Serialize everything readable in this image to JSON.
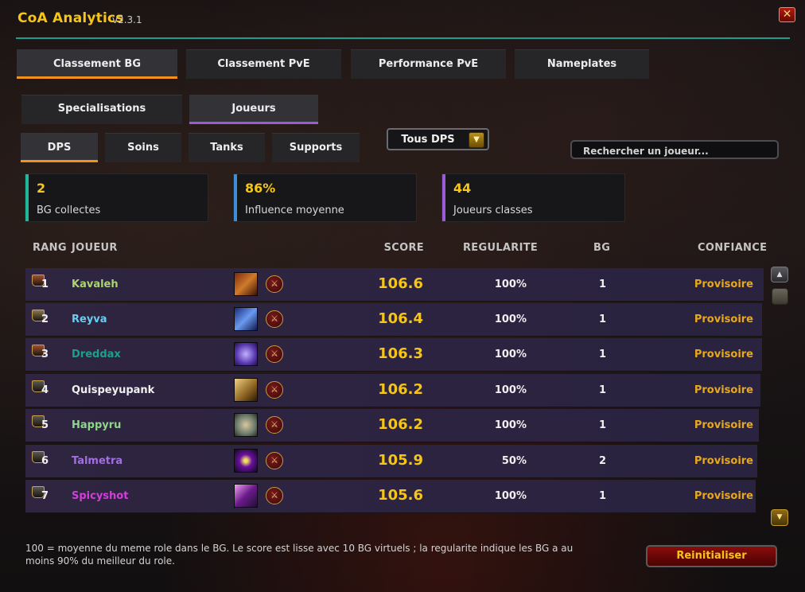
{
  "window": {
    "title": "CoA Analytics",
    "version": "v2.3.1",
    "close_icon": "close-icon"
  },
  "main_tabs": [
    {
      "label": "Classement BG",
      "active": true
    },
    {
      "label": "Classement PvE",
      "active": false
    },
    {
      "label": "Performance PvE",
      "active": false
    },
    {
      "label": "Nameplates",
      "active": false
    }
  ],
  "sub_tabs": [
    {
      "label": "Specialisations",
      "active": false
    },
    {
      "label": "Joueurs",
      "active": true
    }
  ],
  "role_tabs": [
    {
      "label": "DPS",
      "active": true
    },
    {
      "label": "Soins",
      "active": false
    },
    {
      "label": "Tanks",
      "active": false
    },
    {
      "label": "Supports",
      "active": false
    }
  ],
  "filter": {
    "selected": "Tous DPS",
    "icon": "chevron-down-icon"
  },
  "search": {
    "placeholder": "Rechercher un joueur..."
  },
  "stats": [
    {
      "value": "2",
      "label": "BG collectes",
      "color": "#1fb89a"
    },
    {
      "value": "86%",
      "label": "Influence moyenne",
      "color": "#3a8fd8"
    },
    {
      "value": "44",
      "label": "Joueurs classes",
      "color": "#9a5bd8"
    }
  ],
  "table": {
    "headers": {
      "rank": "RANG",
      "player": "JOUEUR",
      "score": "SCORE",
      "regularity": "REGULARITE",
      "bg": "BG",
      "confidence": "CONFIANCE"
    },
    "rows": [
      {
        "rank": "1",
        "name": "Kavaleh",
        "name_color": "#abd473",
        "score": "106.6",
        "regularity": "100%",
        "bg": "1",
        "confidence": "Provisoire",
        "rank_icon_color": "#a0522d",
        "spec_icon": "spec-fury-icon"
      },
      {
        "rank": "2",
        "name": "Reyva",
        "name_color": "#69ccf0",
        "score": "106.4",
        "regularity": "100%",
        "bg": "1",
        "confidence": "Provisoire",
        "rank_icon_color": "#8a7a50",
        "spec_icon": "spec-frost-icon"
      },
      {
        "rank": "3",
        "name": "Dreddax",
        "name_color": "#1e9f8a",
        "score": "106.3",
        "regularity": "100%",
        "bg": "1",
        "confidence": "Provisoire",
        "rank_icon_color": "#a0522d",
        "spec_icon": "spec-arcane-icon"
      },
      {
        "rank": "4",
        "name": "Quispeyupank",
        "name_color": "#f0f0f0",
        "score": "106.2",
        "regularity": "100%",
        "bg": "1",
        "confidence": "Provisoire",
        "rank_icon_color": "#5a5a50",
        "spec_icon": "spec-holy-icon"
      },
      {
        "rank": "5",
        "name": "Happyru",
        "name_color": "#8fd58a",
        "score": "106.2",
        "regularity": "100%",
        "bg": "1",
        "confidence": "Provisoire",
        "rank_icon_color": "#5a5a50",
        "spec_icon": "spec-totem-icon"
      },
      {
        "rank": "6",
        "name": "Talmetra",
        "name_color": "#a070e0",
        "score": "105.9",
        "regularity": "50%",
        "bg": "2",
        "confidence": "Provisoire",
        "rank_icon_color": "#5a5a50",
        "spec_icon": "spec-eye-icon"
      },
      {
        "rank": "7",
        "name": "Spicyshot",
        "name_color": "#d040d8",
        "score": "105.6",
        "regularity": "100%",
        "bg": "1",
        "confidence": "Provisoire",
        "rank_icon_color": "#5a5a50",
        "spec_icon": "spec-shadow-icon"
      }
    ]
  },
  "footer": {
    "note": "100 = moyenne du meme role dans le BG. Le score est lisse avec 10 BG virtuels ; la regularite indique les BG a au moins 90% du meilleur du role.",
    "reset_label": "Reinitialiser"
  }
}
